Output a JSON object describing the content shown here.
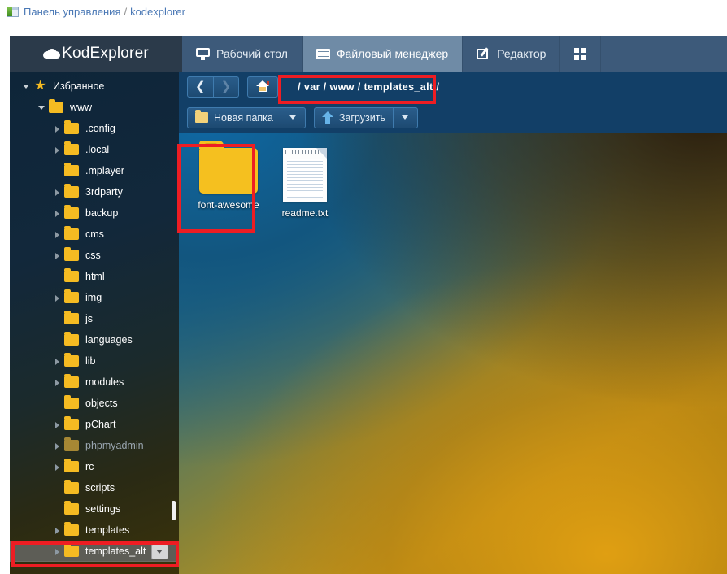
{
  "breadcrumb": {
    "icon": "control-panel-icon",
    "root": "Панель управления",
    "separator": "/",
    "current": "kodexplorer"
  },
  "navbar": {
    "brand": "KodExplorer",
    "brand_icon": "cloud-icon",
    "tabs": [
      {
        "label": "Рабочий стол",
        "icon": "monitor-icon",
        "active": false
      },
      {
        "label": "Файловый менеджер",
        "icon": "files-icon",
        "active": true
      },
      {
        "label": "Редактор",
        "icon": "edit-pencil-icon",
        "active": false
      },
      {
        "label": "",
        "icon": "grid-apps-icon",
        "active": false
      }
    ]
  },
  "toolbar": {
    "back_icon": "chevron-left-icon",
    "forward_icon": "chevron-right-icon",
    "home_icon": "home-icon",
    "path_segments": [
      "var",
      "www",
      "templates_alt"
    ],
    "path_text": "/ var / www / templates_alt /",
    "new_folder_label": "Новая папка",
    "new_folder_icon": "folder-icon",
    "new_folder_caret": "chevron-down-icon",
    "upload_label": "Загрузить",
    "upload_icon": "upload-arrow-icon",
    "upload_caret": "chevron-down-icon"
  },
  "sidebar": {
    "items": [
      {
        "label": "Избранное",
        "icon": "star-icon",
        "indent": 0,
        "twisty": "open",
        "state": "normal"
      },
      {
        "label": "www",
        "icon": "folder-icon",
        "indent": 1,
        "twisty": "open",
        "state": "normal"
      },
      {
        "label": ".config",
        "icon": "folder-icon",
        "indent": 2,
        "twisty": "closed",
        "state": "normal"
      },
      {
        "label": ".local",
        "icon": "folder-icon",
        "indent": 2,
        "twisty": "closed",
        "state": "normal"
      },
      {
        "label": ".mplayer",
        "icon": "folder-icon",
        "indent": 2,
        "twisty": "none",
        "state": "normal"
      },
      {
        "label": "3rdparty",
        "icon": "folder-icon",
        "indent": 2,
        "twisty": "closed",
        "state": "normal"
      },
      {
        "label": "backup",
        "icon": "folder-icon",
        "indent": 2,
        "twisty": "closed",
        "state": "normal"
      },
      {
        "label": "cms",
        "icon": "folder-icon",
        "indent": 2,
        "twisty": "closed",
        "state": "normal"
      },
      {
        "label": "css",
        "icon": "folder-icon",
        "indent": 2,
        "twisty": "closed",
        "state": "normal"
      },
      {
        "label": "html",
        "icon": "folder-icon",
        "indent": 2,
        "twisty": "none",
        "state": "normal"
      },
      {
        "label": "img",
        "icon": "folder-icon",
        "indent": 2,
        "twisty": "closed",
        "state": "normal"
      },
      {
        "label": "js",
        "icon": "folder-icon",
        "indent": 2,
        "twisty": "none",
        "state": "normal"
      },
      {
        "label": "languages",
        "icon": "folder-icon",
        "indent": 2,
        "twisty": "none",
        "state": "normal"
      },
      {
        "label": "lib",
        "icon": "folder-icon",
        "indent": 2,
        "twisty": "closed",
        "state": "normal"
      },
      {
        "label": "modules",
        "icon": "folder-icon",
        "indent": 2,
        "twisty": "closed",
        "state": "normal"
      },
      {
        "label": "objects",
        "icon": "folder-icon",
        "indent": 2,
        "twisty": "none",
        "state": "normal"
      },
      {
        "label": "pChart",
        "icon": "folder-icon",
        "indent": 2,
        "twisty": "closed",
        "state": "normal"
      },
      {
        "label": "phpmyadmin",
        "icon": "folder-icon",
        "indent": 2,
        "twisty": "closed",
        "state": "dimmed"
      },
      {
        "label": "rc",
        "icon": "folder-icon",
        "indent": 2,
        "twisty": "closed",
        "state": "normal"
      },
      {
        "label": "scripts",
        "icon": "folder-icon",
        "indent": 2,
        "twisty": "none",
        "state": "normal"
      },
      {
        "label": "settings",
        "icon": "folder-icon",
        "indent": 2,
        "twisty": "none",
        "state": "normal"
      },
      {
        "label": "templates",
        "icon": "folder-icon",
        "indent": 2,
        "twisty": "closed",
        "state": "normal"
      },
      {
        "label": "templates_alt",
        "icon": "folder-icon",
        "indent": 2,
        "twisty": "closed",
        "state": "selected",
        "caret": "chevron-down-icon"
      }
    ]
  },
  "files": [
    {
      "name": "font-awesome",
      "type": "folder",
      "icon": "folder-large-icon",
      "highlighted": true
    },
    {
      "name": "readme.txt",
      "type": "file",
      "icon": "text-file-icon",
      "highlighted": false
    }
  ],
  "annotations": {
    "color": "#ee1d23",
    "regions": [
      "path-breadcrumb",
      "font-awesome-folder",
      "templates_alt-tree-row"
    ]
  }
}
